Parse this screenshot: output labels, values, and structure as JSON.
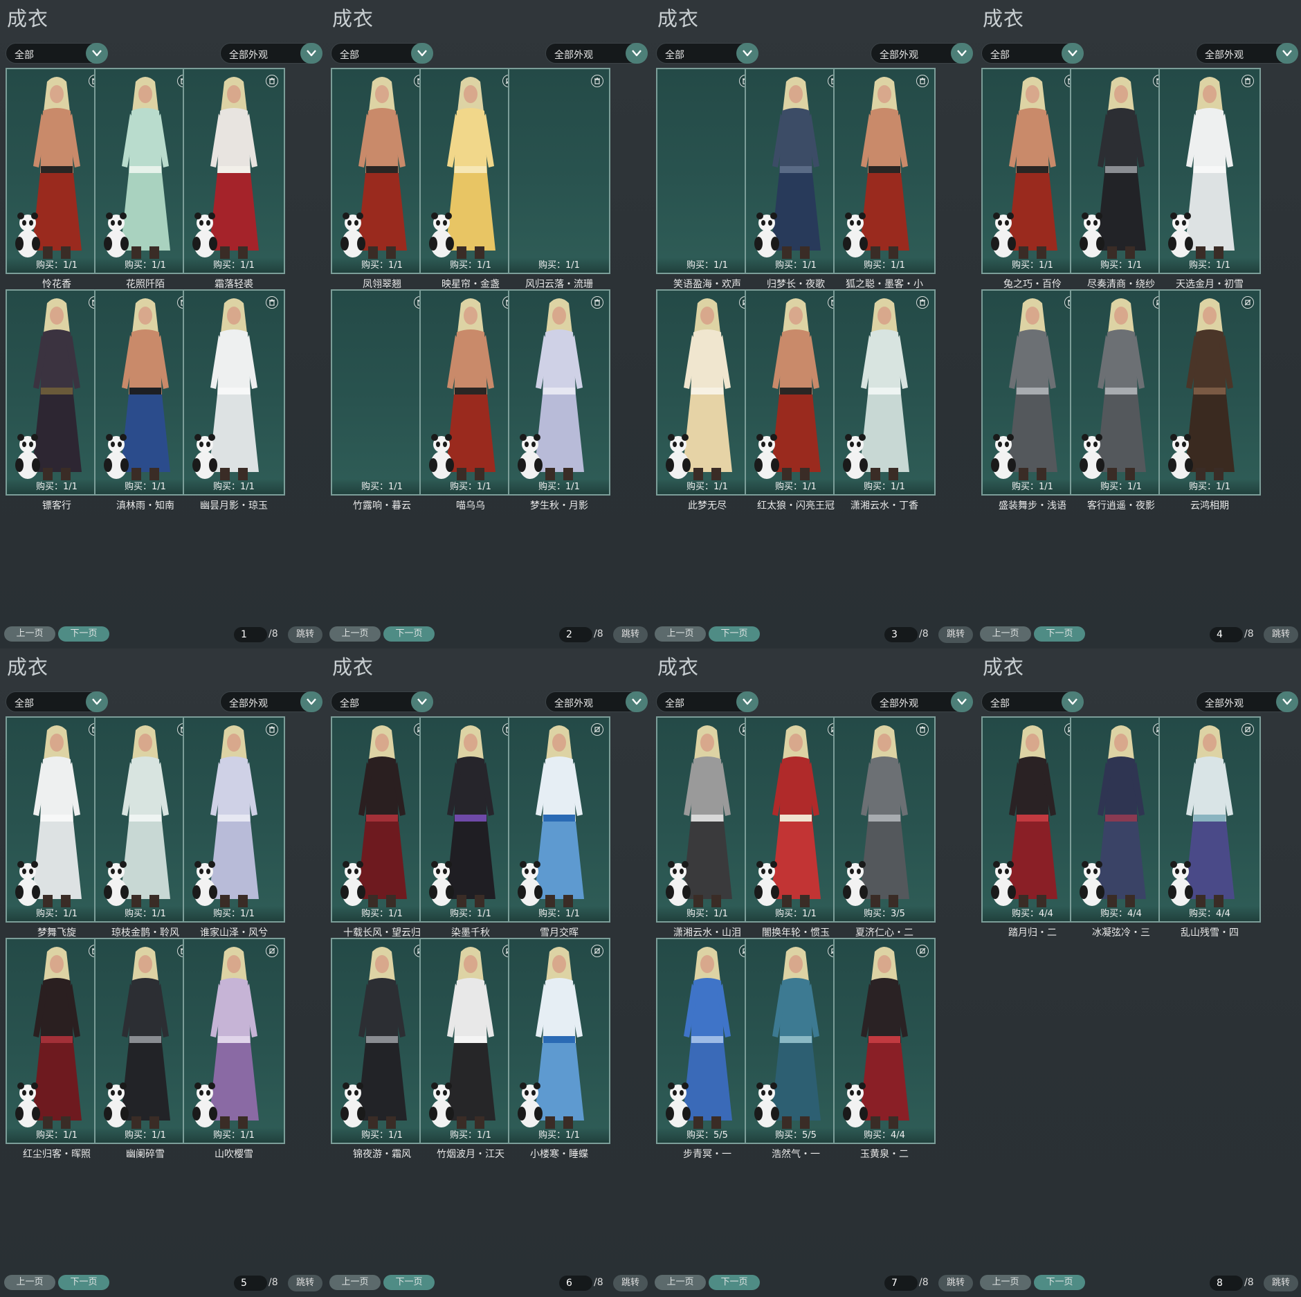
{
  "panels": [
    {
      "title": "成衣",
      "filter_left": "全部",
      "filter_right": "全部外观",
      "page_current": "1",
      "page_total": "/8",
      "prev_label": "上一页",
      "next_label": "下一页",
      "jump_label": "跳转",
      "items": [
        {
          "name": "怜花香",
          "buy": "购买：1/1",
          "icon": "trash-icon",
          "outfit": "shirtless-red",
          "empty": false
        },
        {
          "name": "花照阡陌",
          "buy": "购买：1/1",
          "icon": "trash-icon",
          "outfit": "mint-robe",
          "empty": false
        },
        {
          "name": "霜落轻裘",
          "buy": "购买：1/1",
          "icon": "trash-icon",
          "outfit": "red-white-fur",
          "empty": false
        },
        {
          "name": "镖客行",
          "buy": "购买：1/1",
          "icon": "trash-icon",
          "outfit": "dark-purple-robe",
          "empty": false
        },
        {
          "name": "滇林雨・知南",
          "buy": "购买：1/1",
          "icon": "trash-icon",
          "outfit": "shirtless-blue",
          "empty": false
        },
        {
          "name": "幽昙月影・琼玉",
          "buy": "购买：1/1",
          "icon": "trash-icon",
          "outfit": "white-robe",
          "empty": false
        }
      ]
    },
    {
      "title": "成衣",
      "filter_left": "全部",
      "filter_right": "全部外观",
      "page_current": "2",
      "page_total": "/8",
      "prev_label": "上一页",
      "next_label": "下一页",
      "jump_label": "跳转",
      "items": [
        {
          "name": "凤翎翠翘",
          "buy": "购买：1/1",
          "icon": "trash-icon",
          "outfit": "shirtless-red",
          "empty": false
        },
        {
          "name": "映星帘・金盏",
          "buy": "购买：1/1",
          "icon": "no-trade-icon",
          "outfit": "yellow-robe",
          "empty": false
        },
        {
          "name": "风归云落・流珊",
          "buy": "购买：1/1",
          "icon": "trash-icon",
          "outfit": "none",
          "empty": true
        },
        {
          "name": "竹露响・暮云",
          "buy": "购买：1/1",
          "icon": "trash-icon",
          "outfit": "none",
          "empty": true
        },
        {
          "name": "喵乌乌",
          "buy": "购买：1/1",
          "icon": "trash-icon",
          "outfit": "shirtless-red",
          "empty": false
        },
        {
          "name": "梦生秋・月影",
          "buy": "购买：1/1",
          "icon": "trash-icon",
          "outfit": "lavender-robe",
          "empty": false
        }
      ]
    },
    {
      "title": "成衣",
      "filter_left": "全部",
      "filter_right": "全部外观",
      "page_current": "3",
      "page_total": "/8",
      "prev_label": "上一页",
      "next_label": "下一页",
      "jump_label": "跳转",
      "items": [
        {
          "name": "笑语盈海・欢声",
          "buy": "购买：1/1",
          "icon": "trash-icon",
          "outfit": "none",
          "empty": true
        },
        {
          "name": "归梦长・夜歌",
          "buy": "购买：1/1",
          "icon": "trash-icon",
          "outfit": "navy-robe",
          "empty": false
        },
        {
          "name": "狐之聪・墨客・小",
          "buy": "购买：1/1",
          "icon": "trash-icon",
          "outfit": "shirtless-red",
          "empty": false
        },
        {
          "name": "此梦无尽",
          "buy": "购买：1/1",
          "icon": "no-trade-icon",
          "outfit": "cream-gold-robe",
          "empty": false
        },
        {
          "name": "红太狼・闪亮王冠",
          "buy": "购买：1/1",
          "icon": "trash-icon",
          "outfit": "shirtless-red",
          "empty": false
        },
        {
          "name": "潇湘云水・丁香",
          "buy": "购买：1/1",
          "icon": "trash-icon",
          "outfit": "pale-robe",
          "empty": false
        }
      ]
    },
    {
      "title": "成衣",
      "filter_left": "全部",
      "filter_right": "全部外观",
      "page_current": "4",
      "page_total": "/8",
      "prev_label": "上一页",
      "next_label": "下一页",
      "jump_label": "跳转",
      "items": [
        {
          "name": "兔之巧・百伶",
          "buy": "购买：1/1",
          "icon": "trash-icon",
          "outfit": "shirtless-red",
          "empty": false
        },
        {
          "name": "尽奏清商・绕纱",
          "buy": "购买：1/1",
          "icon": "trash-icon",
          "outfit": "black-robe",
          "empty": false
        },
        {
          "name": "天选金月・初雪",
          "buy": "购买：1/1",
          "icon": "trash-icon",
          "outfit": "white-robe",
          "empty": false
        },
        {
          "name": "盛装舞步・浅语",
          "buy": "购买：1/1",
          "icon": "trash-icon",
          "outfit": "grey-robe",
          "empty": false
        },
        {
          "name": "客行逍遥・夜影",
          "buy": "购买：1/1",
          "icon": "no-trade-icon",
          "outfit": "grey-robe",
          "empty": false
        },
        {
          "name": "云鸿相期",
          "buy": "购买：1/1",
          "icon": "no-trade-icon",
          "outfit": "brown-robe",
          "empty": false
        }
      ]
    },
    {
      "title": "成衣",
      "filter_left": "全部",
      "filter_right": "全部外观",
      "page_current": "5",
      "page_total": "/8",
      "prev_label": "上一页",
      "next_label": "下一页",
      "jump_label": "跳转",
      "items": [
        {
          "name": "梦舞飞旋",
          "buy": "购买：1/1",
          "icon": "trash-icon",
          "outfit": "white-robe",
          "empty": false
        },
        {
          "name": "琼枝金鹊・聆风",
          "buy": "购买：1/1",
          "icon": "trash-icon",
          "outfit": "pale-robe",
          "empty": false
        },
        {
          "name": "谁家山泽・风兮",
          "buy": "购买：1/1",
          "icon": "trash-icon",
          "outfit": "lavender-robe",
          "empty": false
        },
        {
          "name": "红尘归客・晖照",
          "buy": "购买：1/1",
          "icon": "trash-icon",
          "outfit": "black-red-robe",
          "empty": false
        },
        {
          "name": "幽阑碎雪",
          "buy": "购买：1/1",
          "icon": "trash-icon",
          "outfit": "black-robe",
          "empty": false
        },
        {
          "name": "山吹樱雪",
          "buy": "购买：1/1",
          "icon": "no-trade-icon",
          "outfit": "lilac-robe",
          "empty": false
        }
      ]
    },
    {
      "title": "成衣",
      "filter_left": "全部",
      "filter_right": "全部外观",
      "page_current": "6",
      "page_total": "/8",
      "prev_label": "上一页",
      "next_label": "下一页",
      "jump_label": "跳转",
      "items": [
        {
          "name": "十载长风・望云归",
          "buy": "购买：1/1",
          "icon": "no-trade-icon",
          "outfit": "black-red-robe",
          "empty": false
        },
        {
          "name": "染墨千秋",
          "buy": "购买：1/1",
          "icon": "trash-icon",
          "outfit": "black-purple-robe",
          "empty": false
        },
        {
          "name": "雪月交晖",
          "buy": "购买：1/1",
          "icon": "no-trade-icon",
          "outfit": "blue-white-robe",
          "empty": false
        },
        {
          "name": "锦夜游・霜风",
          "buy": "购买：1/1",
          "icon": "no-trade-icon",
          "outfit": "black-robe",
          "empty": false
        },
        {
          "name": "竹烟波月・江天",
          "buy": "购买：1/1",
          "icon": "no-trade-icon",
          "outfit": "black-white-robe",
          "empty": false
        },
        {
          "name": "小楼寒・睡蝶",
          "buy": "购买：1/1",
          "icon": "no-trade-icon",
          "outfit": "blue-white-robe",
          "empty": false
        }
      ]
    },
    {
      "title": "成衣",
      "filter_left": "全部",
      "filter_right": "全部外观",
      "page_current": "7",
      "page_total": "/8",
      "prev_label": "上一页",
      "next_label": "下一页",
      "jump_label": "跳转",
      "items": [
        {
          "name": "潇湘云水・山泪",
          "buy": "购买：1/1",
          "icon": "no-trade-icon",
          "outfit": "grey-black-robe",
          "empty": false
        },
        {
          "name": "闇换年轮・惯玉",
          "buy": "购买：1/1",
          "icon": "no-trade-icon",
          "outfit": "red-robe",
          "empty": false
        },
        {
          "name": "夏济仁心・二",
          "buy": "购买：3/5",
          "icon": "trash-icon",
          "outfit": "grey-robe",
          "empty": false
        },
        {
          "name": "步青冥・一",
          "buy": "购买：5/5",
          "icon": "no-trade-icon",
          "outfit": "blue-armor",
          "empty": false
        },
        {
          "name": "浩然气・一",
          "buy": "购买：5/5",
          "icon": "no-trade-icon",
          "outfit": "teal-armor",
          "empty": false
        },
        {
          "name": "玉黄泉・二",
          "buy": "购买：4/4",
          "icon": "no-trade-icon",
          "outfit": "red-black-armor",
          "empty": false
        }
      ]
    },
    {
      "title": "成衣",
      "filter_left": "全部",
      "filter_right": "全部外观",
      "page_current": "8",
      "page_total": "/8",
      "prev_label": "上一页",
      "next_label": "下一页",
      "jump_label": "跳转",
      "items": [
        {
          "name": "踏月归・二",
          "buy": "购买：4/4",
          "icon": "no-trade-icon",
          "outfit": "red-black-armor",
          "empty": false
        },
        {
          "name": "冰凝弦冷・三",
          "buy": "购买：4/4",
          "icon": "no-trade-icon",
          "outfit": "navy-armor",
          "empty": false
        },
        {
          "name": "乱山残雪・四",
          "buy": "购买：4/4",
          "icon": "no-trade-icon",
          "outfit": "white-purple-armor",
          "empty": false
        }
      ]
    }
  ],
  "palettes": {
    "shirtless-red": {
      "top": "#c98a6a",
      "bottom": "#9a2a1e",
      "accent": "#2a2624"
    },
    "shirtless-blue": {
      "top": "#c98a6a",
      "bottom": "#2b4c8c",
      "accent": "#1d1f24"
    },
    "mint-robe": {
      "top": "#b9dccd",
      "bottom": "#a9d2bf",
      "accent": "#e6f2ea"
    },
    "red-white-fur": {
      "top": "#e8e4e0",
      "bottom": "#a5232a",
      "accent": "#f2efe9"
    },
    "yellow-robe": {
      "top": "#f1d78a",
      "bottom": "#e8c564",
      "accent": "#f6e7b5"
    },
    "navy-robe": {
      "top": "#3c4c66",
      "bottom": "#283a5a",
      "accent": "#5a6b86"
    },
    "cream-gold-robe": {
      "top": "#f0e6cf",
      "bottom": "#e6d3a6",
      "accent": "#f7f1e3"
    },
    "pale-robe": {
      "top": "#d8e4e0",
      "bottom": "#c8d8d4",
      "accent": "#eef4f2"
    },
    "black-robe": {
      "top": "#2c2e33",
      "bottom": "#222327",
      "accent": "#8a8d92"
    },
    "white-robe": {
      "top": "#eef0f0",
      "bottom": "#dde2e3",
      "accent": "#f7f8f8"
    },
    "dark-purple-robe": {
      "top": "#3b3340",
      "bottom": "#2d2632",
      "accent": "#6a5a3a"
    },
    "lavender-robe": {
      "top": "#cfd1e6",
      "bottom": "#b8bbd8",
      "accent": "#e6e7f2"
    },
    "grey-robe": {
      "top": "#6c7074",
      "bottom": "#54585c",
      "accent": "#a8acb0"
    },
    "brown-robe": {
      "top": "#4a3528",
      "bottom": "#3a2a20",
      "accent": "#7a5a44"
    },
    "black-red-robe": {
      "top": "#2a1f20",
      "bottom": "#6e1a1f",
      "accent": "#a33038"
    },
    "lilac-robe": {
      "top": "#c6b4d6",
      "bottom": "#8a6aa4",
      "accent": "#e0d4ea"
    },
    "black-purple-robe": {
      "top": "#26252b",
      "bottom": "#1f1e23",
      "accent": "#6f4aa8"
    },
    "blue-white-robe": {
      "top": "#e6eef4",
      "bottom": "#5e9ad0",
      "accent": "#2a6ab4"
    },
    "black-white-robe": {
      "top": "#e8e8e8",
      "bottom": "#262628",
      "accent": "#f4f4f4"
    },
    "grey-black-robe": {
      "top": "#9a9a9a",
      "bottom": "#3a3a3c",
      "accent": "#d8d8d8"
    },
    "red-robe": {
      "top": "#b02a2a",
      "bottom": "#c23434",
      "accent": "#f0e2d0"
    },
    "blue-armor": {
      "top": "#3f74c8",
      "bottom": "#3a6ab8",
      "accent": "#9dbbe6"
    },
    "teal-armor": {
      "top": "#3d7a92",
      "bottom": "#2d5f72",
      "accent": "#8ab8c4"
    },
    "red-black-armor": {
      "top": "#2a2224",
      "bottom": "#8a1f26",
      "accent": "#c23a40"
    },
    "navy-armor": {
      "top": "#2f3552",
      "bottom": "#3a4366",
      "accent": "#8a3a52"
    },
    "white-purple-armor": {
      "top": "#d9e4e6",
      "bottom": "#4a4a88",
      "accent": "#8ab4c0"
    }
  },
  "colors": {
    "background": "#2b3034",
    "card_bg": "#27504c",
    "card_border": "#7c9e99",
    "accent_button": "#4f8c85"
  }
}
